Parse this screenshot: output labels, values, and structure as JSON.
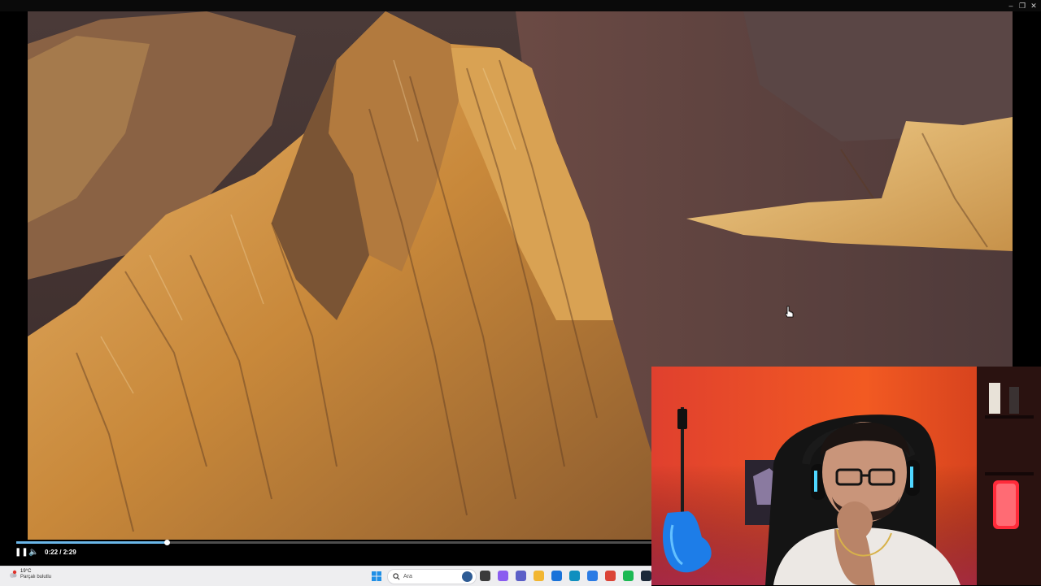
{
  "window_controls": {
    "minimize_glyph": "–",
    "restore_glyph": "❐",
    "close_glyph": "✕"
  },
  "player": {
    "current_time": "0:22",
    "separator": " / ",
    "duration": "2:29",
    "progress_fraction": 0.237,
    "pause_glyph": "❚❚",
    "volume_glyph": "🔈"
  },
  "taskbar": {
    "weather": {
      "temperature": "19°C",
      "description": "Parçalı bulutlu",
      "badge_color": "#e0322b"
    },
    "search": {
      "placeholder": "Ara"
    },
    "apps": [
      {
        "name": "task-view-icon",
        "color": "#3b3b3b"
      },
      {
        "name": "copilot-icon",
        "color": "#8a5cf0"
      },
      {
        "name": "teams-icon",
        "color": "#5b5fc7"
      },
      {
        "name": "file-explorer-icon",
        "color": "#f2b631"
      },
      {
        "name": "mail-icon",
        "color": "#1a73d9"
      },
      {
        "name": "edge-icon",
        "color": "#0f8fbf"
      },
      {
        "name": "store-icon",
        "color": "#2a7be4"
      },
      {
        "name": "chrome-icon",
        "color": "#db4437"
      },
      {
        "name": "spotify-icon",
        "color": "#1db954"
      },
      {
        "name": "steam-icon",
        "color": "#1b2838"
      },
      {
        "name": "shield-icon",
        "color": "#3c3c3c"
      }
    ]
  }
}
